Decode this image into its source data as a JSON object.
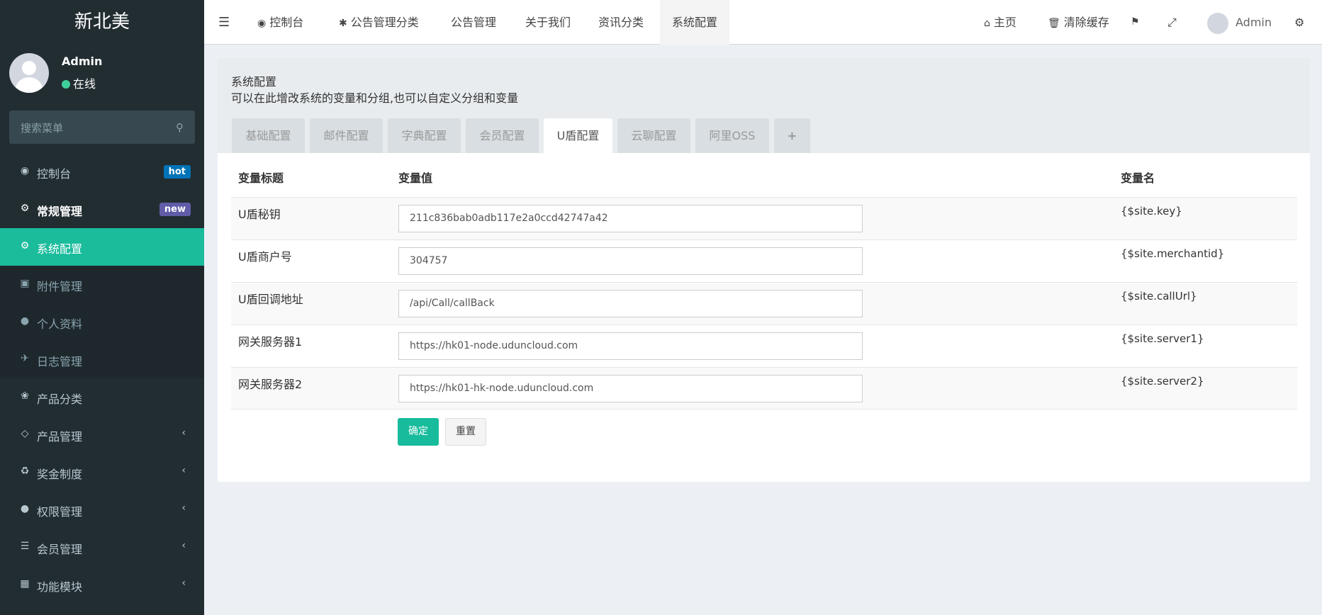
{
  "sidebar": {
    "logo": "新北美",
    "user": {
      "name": "Admin",
      "status": "在线"
    },
    "search_placeholder": "搜索菜单",
    "items": [
      {
        "label": "控制台",
        "icon": "dashboard-icon",
        "badge": "hot"
      },
      {
        "label": "常规管理",
        "icon": "cogs-icon",
        "badge": "new"
      },
      {
        "label": "系统配置",
        "icon": "gear-icon"
      },
      {
        "label": "附件管理",
        "icon": "file-image-icon"
      },
      {
        "label": "个人资料",
        "icon": "user-icon"
      },
      {
        "label": "日志管理",
        "icon": "plane-icon"
      },
      {
        "label": "产品分类",
        "icon": "leaf-icon"
      },
      {
        "label": "产品管理",
        "icon": "diamond-icon"
      },
      {
        "label": "奖金制度",
        "icon": "recycle-icon"
      },
      {
        "label": "权限管理",
        "icon": "group-icon"
      },
      {
        "label": "会员管理",
        "icon": "list-icon"
      },
      {
        "label": "功能模块",
        "icon": "th-large-icon"
      }
    ]
  },
  "topbar": {
    "tabs": [
      {
        "label": "控制台",
        "icon": "dashboard-icon"
      },
      {
        "label": "公告管理分类",
        "icon": "asterisk-icon"
      },
      {
        "label": "公告管理"
      },
      {
        "label": "关于我们"
      },
      {
        "label": "资讯分类"
      },
      {
        "label": "系统配置"
      }
    ],
    "home": "主页",
    "clear_cache": "清除缓存",
    "user": "Admin"
  },
  "config": {
    "title": "系统配置",
    "description": "可以在此增改系统的变量和分组,也可以自定义分组和变量",
    "tabs": [
      "基础配置",
      "邮件配置",
      "字典配置",
      "会员配置",
      "U盾配置",
      "云聊配置",
      "阿里OSS",
      "+"
    ],
    "active_tab": "U盾配置",
    "columns": [
      "变量标题",
      "变量值",
      "变量名"
    ],
    "rows": [
      {
        "title": "U盾秘钥",
        "value": "211c836bab0adb117e2a0ccd42747a42",
        "name": "{$site.key}"
      },
      {
        "title": "U盾商户号",
        "value": "304757",
        "name": "{$site.merchantid}"
      },
      {
        "title": "U盾回调地址",
        "value": "/api/Call/callBack",
        "name": "{$site.callUrl}"
      },
      {
        "title": "网关服务器1",
        "value": "https://hk01-node.uduncloud.com",
        "name": "{$site.server1}"
      },
      {
        "title": "网关服务器2",
        "value": "https://hk01-hk-node.uduncloud.com",
        "name": "{$site.server2}"
      }
    ],
    "buttons": {
      "ok": "确定",
      "reset": "重置"
    }
  }
}
